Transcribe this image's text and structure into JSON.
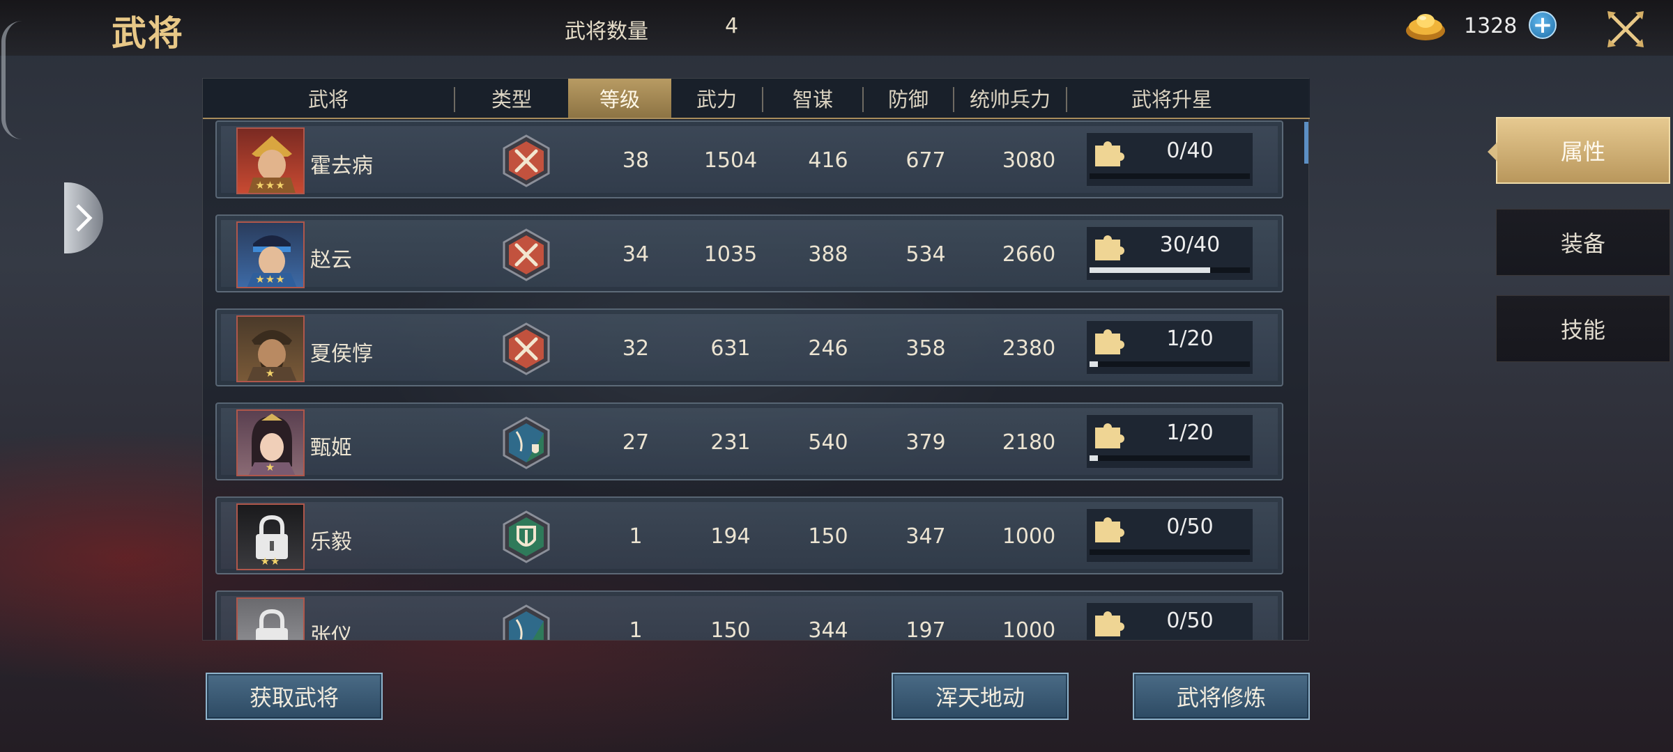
{
  "header": {
    "title": "武将",
    "count_label": "武将数量",
    "count_value": "4",
    "gold_value": "1328",
    "plus_label": "+"
  },
  "table": {
    "columns": [
      "武将",
      "类型",
      "等级",
      "武力",
      "智谋",
      "防御",
      "统帅兵力",
      "武将升星"
    ],
    "active_column": "等级",
    "rows": [
      {
        "name": "霍去病",
        "stars": "★★★",
        "type": "attack",
        "level": "38",
        "force": "1504",
        "intellect": "416",
        "defense": "677",
        "troops": "3080",
        "star_progress": "0/40",
        "progress": 0,
        "locked": false
      },
      {
        "name": "赵云",
        "stars": "★★★",
        "type": "attack",
        "level": "34",
        "force": "1035",
        "intellect": "388",
        "defense": "534",
        "troops": "2660",
        "star_progress": "30/40",
        "progress": 0.75,
        "locked": false
      },
      {
        "name": "夏侯惇",
        "stars": "★",
        "type": "attack",
        "level": "32",
        "force": "631",
        "intellect": "246",
        "defense": "358",
        "troops": "2380",
        "star_progress": "1/20",
        "progress": 0.05,
        "locked": false
      },
      {
        "name": "甄姬",
        "stars": "★",
        "type": "support",
        "level": "27",
        "force": "231",
        "intellect": "540",
        "defense": "379",
        "troops": "2180",
        "star_progress": "1/20",
        "progress": 0.05,
        "locked": false
      },
      {
        "name": "乐毅",
        "stars": "★★",
        "type": "defense",
        "level": "1",
        "force": "194",
        "intellect": "150",
        "defense": "347",
        "troops": "1000",
        "star_progress": "0/50",
        "progress": 0,
        "locked": true
      },
      {
        "name": "张仪",
        "stars": "",
        "type": "support",
        "level": "1",
        "force": "150",
        "intellect": "344",
        "defense": "197",
        "troops": "1000",
        "star_progress": "0/50",
        "progress": 0,
        "locked": true
      }
    ]
  },
  "buttons": {
    "acquire": "获取武将",
    "skill": "浑天地动",
    "train": "武将修炼"
  },
  "side_tabs": [
    {
      "label": "属性",
      "active": true
    },
    {
      "label": "装备",
      "active": false
    },
    {
      "label": "技能",
      "active": false
    }
  ],
  "colors": {
    "accent_gold": "#e8c887",
    "attack_type": "#c2523e",
    "defense_type": "#2f7a5a",
    "support_type": "#2f6a8a"
  },
  "icons": {
    "gold": "gold-ingot-icon",
    "plus": "plus-icon",
    "close": "crossed-swords-close-icon",
    "expand": "chevron-right-icon",
    "star_piece": "puzzle-piece-icon",
    "lock": "lock-icon"
  }
}
